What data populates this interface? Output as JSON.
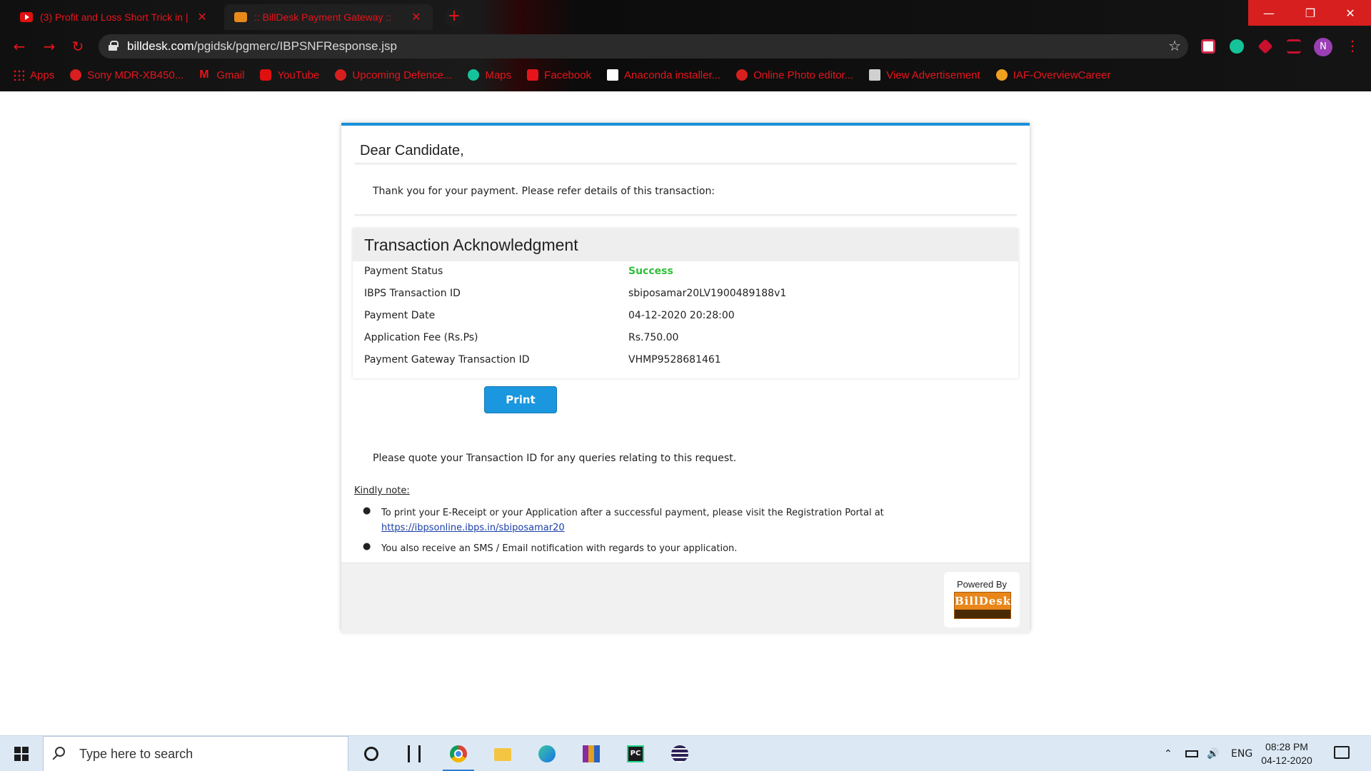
{
  "browser": {
    "tabs": [
      {
        "title": "(3) Profit and Loss Short Trick in |",
        "close": "✕"
      },
      {
        "title": ":: BillDesk Payment Gateway ::",
        "close": "✕"
      }
    ],
    "new_tab": "+",
    "window_controls": {
      "minimize": "—",
      "maximize": "❐",
      "close": "✕"
    },
    "nav": {
      "back": "←",
      "forward": "→",
      "reload": "↻"
    },
    "url_host": "billdesk.com",
    "url_path": "/pgidsk/pgmerc/IBPSNFResponse.jsp",
    "star": "☆",
    "profile_initial": "N",
    "menu": "⋮",
    "bookmarks": [
      {
        "label": "Apps",
        "icon": "apps-grid-icon"
      },
      {
        "label": "Sony MDR-XB450...",
        "icon": "globe-icon"
      },
      {
        "label": "Gmail",
        "icon": "gmail-icon"
      },
      {
        "label": "YouTube",
        "icon": "youtube-icon"
      },
      {
        "label": "Upcoming Defence...",
        "icon": "globe-icon"
      },
      {
        "label": "Maps",
        "icon": "grammarly-icon"
      },
      {
        "label": "Facebook",
        "icon": "pocket-icon"
      },
      {
        "label": "Anaconda installer...",
        "icon": "anaconda-icon"
      },
      {
        "label": "Online Photo editor...",
        "icon": "globe-icon"
      },
      {
        "label": "View Advertisement",
        "icon": "emblem-icon"
      },
      {
        "label": "IAF-OverviewCareer",
        "icon": "iaf-roundel-icon"
      }
    ]
  },
  "page": {
    "greeting": "Dear Candidate,",
    "intro": "Thank you for your payment. Please refer details of this transaction:",
    "ack_title": "Transaction Acknowledgment",
    "rows": [
      {
        "label": "Payment Status",
        "value": "Success"
      },
      {
        "label": "IBPS Transaction ID",
        "value": "sbiposamar20LV1900489188v1"
      },
      {
        "label": "Payment Date",
        "value": "04-12-2020 20:28:00"
      },
      {
        "label": "Application Fee (Rs.Ps)",
        "value": "Rs.750.00"
      },
      {
        "label": "Payment Gateway Transaction ID",
        "value": "VHMP9528681461"
      }
    ],
    "print_label": "Print",
    "quote": "Please quote your Transaction ID for any queries relating to this request.",
    "kindly_note": "Kindly note:",
    "notes": [
      {
        "text": "To print your E-Receipt or your Application after a successful payment, please visit the Registration Portal at",
        "link": "https://ibpsonline.ibps.in/sbiposamar20"
      },
      {
        "text": "You also receive an SMS / Email notification with regards to your application."
      }
    ],
    "powered_by": "Powered By",
    "logo_text": "BillDesk",
    "status_color": "#2fbf3a",
    "accent_color": "#1a8fd8"
  },
  "taskbar": {
    "search_placeholder": "Type here to search",
    "tray_lang": "ENG",
    "time": "08:28 PM",
    "date": "04-12-2020",
    "tray_chevron": "⌃"
  }
}
